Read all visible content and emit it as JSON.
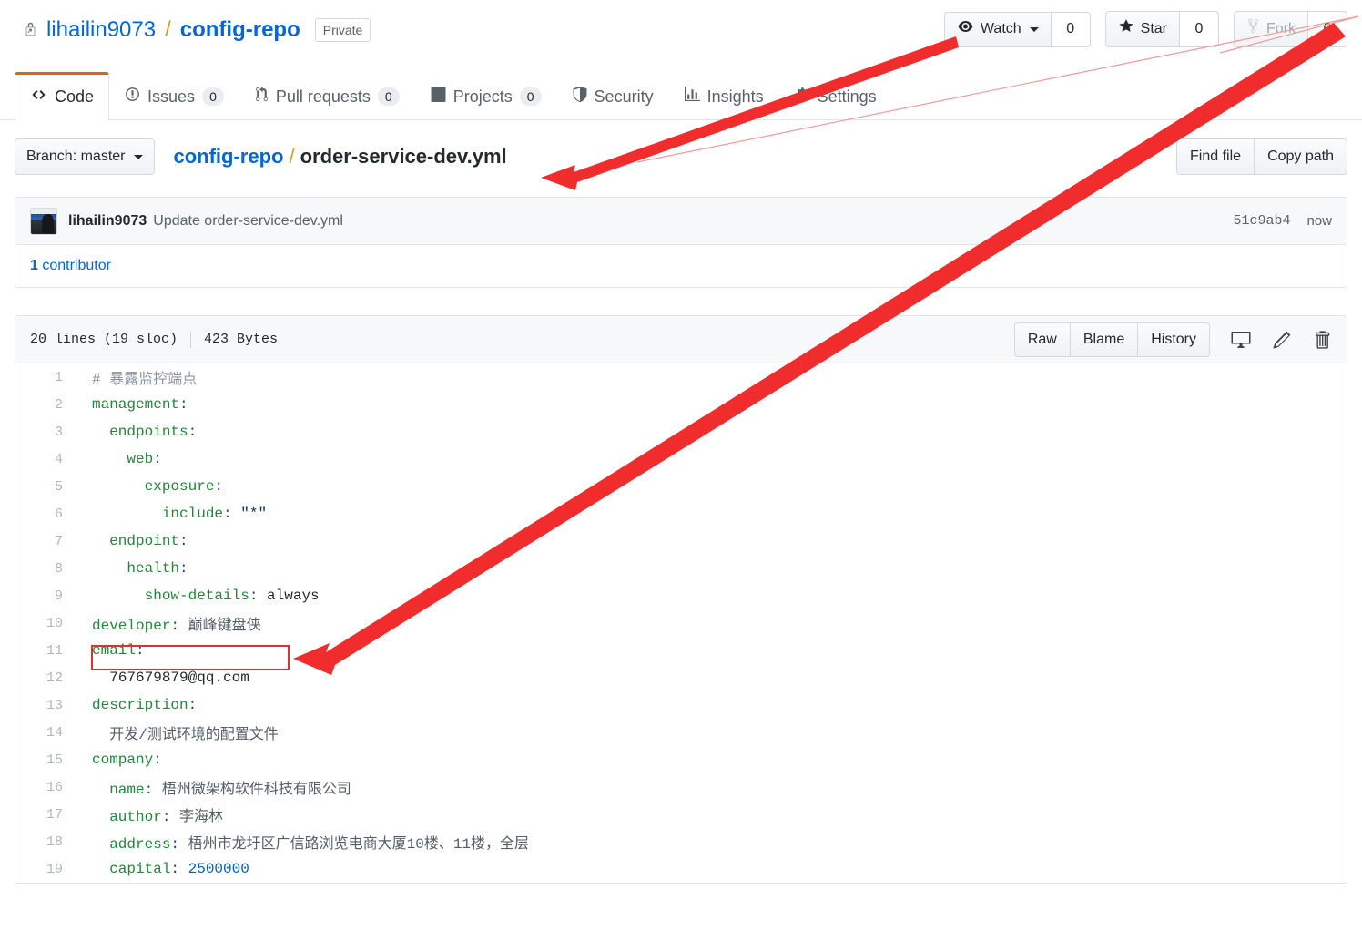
{
  "header": {
    "lock_icon": "lock-icon",
    "owner": "lihailin9073",
    "separator": "/",
    "repo": "config-repo",
    "visibility_badge": "Private",
    "actions": [
      {
        "label": "Watch",
        "count": "0",
        "icon": "eye-icon",
        "has_caret": true,
        "disabled": false
      },
      {
        "label": "Star",
        "count": "0",
        "icon": "star-icon",
        "has_caret": false,
        "disabled": false
      },
      {
        "label": "Fork",
        "count": "0",
        "icon": "fork-icon",
        "has_caret": false,
        "disabled": true
      }
    ]
  },
  "nav": {
    "tabs": [
      {
        "label": "Code",
        "icon": "code-icon",
        "count": null,
        "active": true
      },
      {
        "label": "Issues",
        "icon": "issue-opened-icon",
        "count": "0",
        "active": false
      },
      {
        "label": "Pull requests",
        "icon": "git-pull-request-icon",
        "count": "0",
        "active": false
      },
      {
        "label": "Projects",
        "icon": "project-board-icon",
        "count": "0",
        "active": false
      },
      {
        "label": "Security",
        "icon": "shield-icon",
        "count": null,
        "active": false
      },
      {
        "label": "Insights",
        "icon": "graph-icon",
        "count": null,
        "active": false
      },
      {
        "label": "Settings",
        "icon": "gear-icon",
        "count": null,
        "active": false
      }
    ]
  },
  "file_nav": {
    "branch_label": "Branch: master",
    "breadcrumb_repo": "config-repo",
    "breadcrumb_sep": "/",
    "breadcrumb_file": "order-service-dev.yml",
    "find_file": "Find file",
    "copy_path": "Copy path"
  },
  "commit": {
    "avatar": "user-avatar",
    "author": "lihailin9073",
    "message": "Update order-service-dev.yml",
    "sha": "51c9ab4",
    "time": "now",
    "contributors_count": "1",
    "contributors_label": " contributor"
  },
  "file": {
    "lines_label": "20 lines (19 sloc)",
    "size_label": "423 Bytes",
    "buttons": [
      "Raw",
      "Blame",
      "History"
    ],
    "icons": [
      "desktop-download-icon",
      "pencil-icon",
      "trash-icon"
    ]
  },
  "code": {
    "lines": [
      {
        "n": "1",
        "tokens": [
          {
            "t": "comment",
            "v": "# 暴露监控端点"
          }
        ]
      },
      {
        "n": "2",
        "tokens": [
          {
            "t": "key",
            "v": "management"
          },
          {
            "t": "punc",
            "v": ":"
          }
        ]
      },
      {
        "n": "3",
        "tokens": [
          {
            "t": "plain",
            "v": "  "
          },
          {
            "t": "key",
            "v": "endpoints"
          },
          {
            "t": "punc",
            "v": ":"
          }
        ]
      },
      {
        "n": "4",
        "tokens": [
          {
            "t": "plain",
            "v": "    "
          },
          {
            "t": "key",
            "v": "web"
          },
          {
            "t": "punc",
            "v": ":"
          }
        ]
      },
      {
        "n": "5",
        "tokens": [
          {
            "t": "plain",
            "v": "      "
          },
          {
            "t": "key",
            "v": "exposure"
          },
          {
            "t": "punc",
            "v": ":"
          }
        ]
      },
      {
        "n": "6",
        "tokens": [
          {
            "t": "plain",
            "v": "        "
          },
          {
            "t": "key",
            "v": "include"
          },
          {
            "t": "punc",
            "v": ": "
          },
          {
            "t": "str",
            "v": "\"*\""
          }
        ]
      },
      {
        "n": "7",
        "tokens": [
          {
            "t": "plain",
            "v": "  "
          },
          {
            "t": "key",
            "v": "endpoint"
          },
          {
            "t": "punc",
            "v": ":"
          }
        ]
      },
      {
        "n": "8",
        "tokens": [
          {
            "t": "plain",
            "v": "    "
          },
          {
            "t": "key",
            "v": "health"
          },
          {
            "t": "punc",
            "v": ":"
          }
        ]
      },
      {
        "n": "9",
        "tokens": [
          {
            "t": "plain",
            "v": "      "
          },
          {
            "t": "key",
            "v": "show-details"
          },
          {
            "t": "punc",
            "v": ": "
          },
          {
            "t": "plain",
            "v": "always"
          }
        ]
      },
      {
        "n": "10",
        "tokens": [
          {
            "t": "key",
            "v": "developer"
          },
          {
            "t": "punc",
            "v": ": "
          },
          {
            "t": "cn",
            "v": "巅峰键盘侠"
          }
        ]
      },
      {
        "n": "11",
        "tokens": [
          {
            "t": "key",
            "v": "email"
          },
          {
            "t": "punc",
            "v": ":"
          }
        ]
      },
      {
        "n": "12",
        "tokens": [
          {
            "t": "plain",
            "v": "  "
          },
          {
            "t": "plain",
            "v": "767679879@qq.com"
          }
        ]
      },
      {
        "n": "13",
        "tokens": [
          {
            "t": "key",
            "v": "description"
          },
          {
            "t": "punc",
            "v": ":"
          }
        ]
      },
      {
        "n": "14",
        "tokens": [
          {
            "t": "plain",
            "v": "  "
          },
          {
            "t": "cn",
            "v": "开发/测试环境的配置文件"
          }
        ]
      },
      {
        "n": "15",
        "tokens": [
          {
            "t": "key",
            "v": "company"
          },
          {
            "t": "punc",
            "v": ":"
          }
        ]
      },
      {
        "n": "16",
        "tokens": [
          {
            "t": "plain",
            "v": "  "
          },
          {
            "t": "key",
            "v": "name"
          },
          {
            "t": "punc",
            "v": ": "
          },
          {
            "t": "cn",
            "v": "梧州微架构软件科技有限公司"
          }
        ]
      },
      {
        "n": "17",
        "tokens": [
          {
            "t": "plain",
            "v": "  "
          },
          {
            "t": "key",
            "v": "author"
          },
          {
            "t": "punc",
            "v": ": "
          },
          {
            "t": "cn",
            "v": "李海林"
          }
        ]
      },
      {
        "n": "18",
        "tokens": [
          {
            "t": "plain",
            "v": "  "
          },
          {
            "t": "key",
            "v": "address"
          },
          {
            "t": "punc",
            "v": ": "
          },
          {
            "t": "cn",
            "v": "梧州市龙圩区广信路浏览电商大厦10楼、11楼，全层"
          }
        ]
      },
      {
        "n": "19",
        "tokens": [
          {
            "t": "plain",
            "v": "  "
          },
          {
            "t": "key",
            "v": "capital"
          },
          {
            "t": "punc",
            "v": ": "
          },
          {
            "t": "num",
            "v": "2500000"
          }
        ]
      }
    ]
  },
  "annotations": {
    "color": "#f02c2c",
    "thin_line_color": "#f08a8a",
    "arrows": [
      {
        "name": "arrow-to-filename",
        "target": "breadcrumb_file"
      },
      {
        "name": "arrow-to-developer-line",
        "target": "code_line_10"
      }
    ],
    "highlight": {
      "name": "developer-line-highlight",
      "target": "code_line_10"
    }
  }
}
